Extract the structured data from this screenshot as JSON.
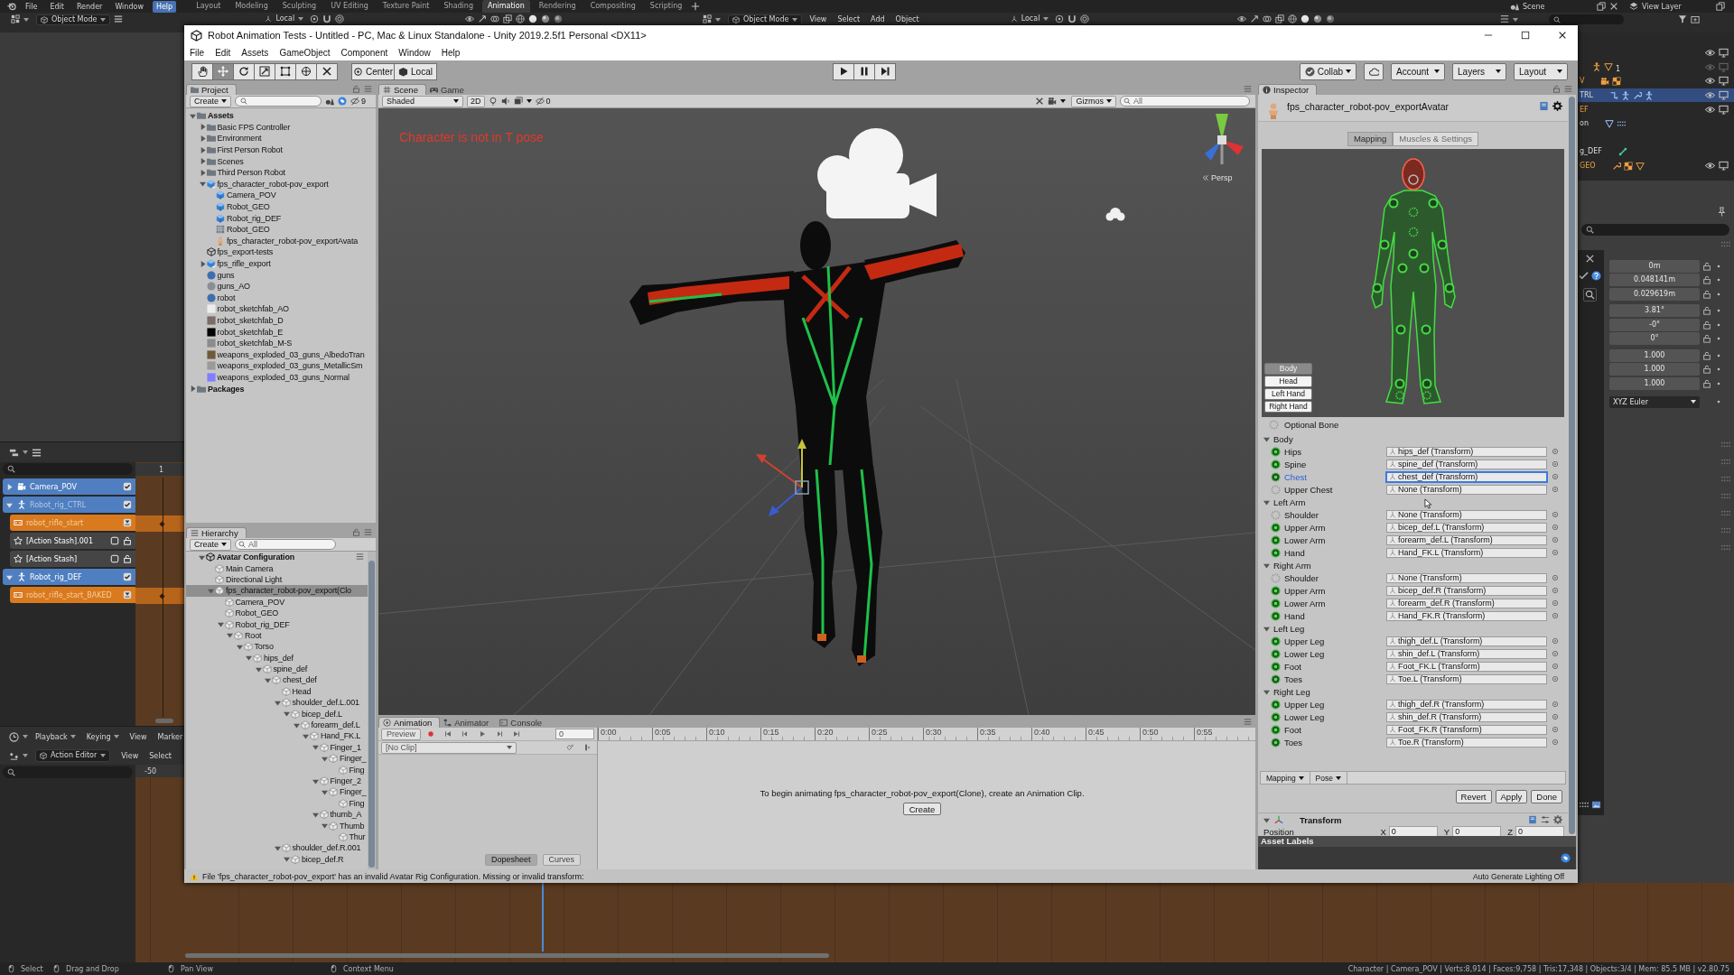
{
  "blender": {
    "menu": [
      {
        "label": "File",
        "highlighted": false
      },
      {
        "label": "Edit",
        "highlighted": false
      },
      {
        "label": "Render",
        "highlighted": false
      },
      {
        "label": "Window",
        "highlighted": false
      },
      {
        "label": "Help",
        "highlighted": true
      }
    ],
    "workspaces": [
      {
        "label": "Layout",
        "selected": false
      },
      {
        "label": "Modeling",
        "selected": false
      },
      {
        "label": "Sculpting",
        "selected": false
      },
      {
        "label": "UV Editing",
        "selected": false
      },
      {
        "label": "Texture Paint",
        "selected": false
      },
      {
        "label": "Shading",
        "selected": false
      },
      {
        "label": "Animation",
        "selected": true
      },
      {
        "label": "Rendering",
        "selected": false
      },
      {
        "label": "Compositing",
        "selected": false
      },
      {
        "label": "Scripting",
        "selected": false
      }
    ],
    "scene": "Scene",
    "view_layer": "View Layer",
    "viewport_header": {
      "mode": "Object Mode",
      "orientation": "Local"
    },
    "viewport_header_2": {
      "mode": "Object Mode",
      "menus": [
        "View",
        "Select",
        "Add",
        "Object"
      ],
      "orientation": "Local"
    },
    "outliner": {
      "rows": [
        {
          "kind": "object",
          "highlighted": false,
          "visible": true
        },
        {
          "kind": "armature",
          "count": "1",
          "highlighted": false,
          "selected": true,
          "visible": false
        },
        {
          "kind": "camera",
          "label": "V",
          "highlighted": false,
          "selected": true,
          "visible": true
        },
        {
          "kind": "rig",
          "label": "TRL",
          "highlighted": true,
          "selected": false,
          "visible": true
        },
        {
          "kind": "object",
          "label": "EF",
          "highlighted": false,
          "selected": true,
          "visible": true
        },
        {
          "kind": "action",
          "label": "on",
          "highlighted": false,
          "selected": false
        },
        {
          "kind": "bone",
          "label": "g_DEF",
          "highlighted": false,
          "selected": false
        },
        {
          "kind": "mesh",
          "label": "GEO",
          "highlighted": false,
          "selected": true,
          "visible": true
        }
      ]
    },
    "properties": {
      "groups": [
        [
          "0m",
          "0.048141m",
          "0.029619m"
        ],
        [
          "3.81°",
          "-0°",
          "0°"
        ],
        [
          "1.000",
          "1.000",
          "1.000"
        ]
      ],
      "rotation_mode": "XYZ Euler"
    },
    "nla": {
      "frame": "1",
      "tracks": [
        {
          "kind": "camera",
          "label": "Camera_POV",
          "expanded": false,
          "checked": true,
          "dimmed": false
        },
        {
          "kind": "armature",
          "label": "Robot_rig_CTRL",
          "expanded": true,
          "checked": true,
          "dimmed": true
        },
        {
          "kind": "action",
          "label": "robot_rifle_start",
          "dimmed": true
        },
        {
          "kind": "stash",
          "label": "[Action Stash].001",
          "checked": false,
          "dimmed": false
        },
        {
          "kind": "stash",
          "label": "[Action Stash]",
          "checked": false,
          "dimmed": false
        },
        {
          "kind": "armature",
          "label": "Robot_rig_DEF",
          "expanded": true,
          "checked": true,
          "dimmed": false
        },
        {
          "kind": "action",
          "label": "robot_rifle_start_BAKED",
          "dimmed": true
        }
      ]
    },
    "timeline": {
      "menus": [
        {
          "label": "Playback",
          "dropdown": true
        },
        {
          "label": "Keying",
          "dropdown": true
        },
        {
          "label": "View",
          "dropdown": false
        },
        {
          "label": "Marker",
          "dropdown": false
        }
      ]
    },
    "action_editor": {
      "mode": "Action Editor",
      "menus": [
        "View",
        "Select"
      ],
      "frame": "-50"
    },
    "status": {
      "hints": [
        "Select",
        "Drag and Drop",
        "Pan View",
        "Context Menu"
      ],
      "stats": "Character | Camera_POV | Verts:8,914 | Faces:9,758 | Tris:17,348 | Objects:3/4 | Mem: 85.5 MB | v2.80.75"
    }
  },
  "unity": {
    "title": "Robot Animation Tests - Untitled - PC, Mac & Linux Standalone - Unity 2019.2.5f1 Personal <DX11>",
    "menu": [
      "File",
      "Edit",
      "Assets",
      "GameObject",
      "Component",
      "Window",
      "Help"
    ],
    "tools": [
      {
        "selected": false
      },
      {
        "selected": true
      },
      {
        "selected": false
      },
      {
        "selected": false
      },
      {
        "selected": false
      },
      {
        "selected": false
      },
      {
        "selected": false
      }
    ],
    "pivot_mode": "Center",
    "pivot_rotation": "Local",
    "collab": "Collab",
    "account": "Account",
    "layers": "Layers",
    "layout": "Layout",
    "project": {
      "tab": "Project",
      "create": "Create",
      "hidden_count": "9",
      "items": [
        {
          "label": "Assets",
          "kind": "folder",
          "expanded": true,
          "children": [
            {
              "label": "Basic FPS Controller",
              "kind": "folder",
              "expanded": false
            },
            {
              "label": "Environment",
              "kind": "folder",
              "expanded": false
            },
            {
              "label": "First Person Robot",
              "kind": "folder",
              "expanded": false
            },
            {
              "label": "Scenes",
              "kind": "folder",
              "expanded": false
            },
            {
              "label": "Third Person Robot",
              "kind": "folder",
              "expanded": false
            },
            {
              "label": "fps_character_robot-pov_export",
              "kind": "model",
              "expanded": true,
              "children": [
                {
                  "label": "Camera_POV",
                  "kind": "cube"
                },
                {
                  "label": "Robot_GEO",
                  "kind": "cube"
                },
                {
                  "label": "Robot_rig_DEF",
                  "kind": "cube"
                },
                {
                  "label": "Robot_GEO",
                  "kind": "mesh"
                },
                {
                  "label": "fps_character_robot-pov_exportAvata",
                  "kind": "avatar"
                }
              ]
            },
            {
              "label": "fps_export-tests",
              "kind": "scene"
            },
            {
              "label": "fps_rifle_export",
              "kind": "model",
              "expanded": false
            },
            {
              "label": "guns",
              "kind": "material",
              "color": "#3d6fb0"
            },
            {
              "label": "guns_AO",
              "kind": "material",
              "color": "#8a8f96"
            },
            {
              "label": "robot",
              "kind": "material",
              "color": "#3d6fb0"
            },
            {
              "label": "robot_sketchfab_AO",
              "kind": "texture",
              "color": "#ededed"
            },
            {
              "label": "robot_sketchfab_D",
              "kind": "texture",
              "color": "#7a6c68"
            },
            {
              "label": "robot_sketchfab_E",
              "kind": "texture",
              "color": "#050505"
            },
            {
              "label": "robot_sketchfab_M-S",
              "kind": "texture",
              "color": "#8c8c8c"
            },
            {
              "label": "weapons_exploded_03_guns_AlbedoTran",
              "kind": "texture",
              "color": "#6e5a3a"
            },
            {
              "label": "weapons_exploded_03_guns_MetallicSm",
              "kind": "texture",
              "color": "#9a9a9a"
            },
            {
              "label": "weapons_exploded_03_guns_Normal",
              "kind": "texture",
              "color": "#7f7fff"
            }
          ]
        },
        {
          "label": "Packages",
          "kind": "folder",
          "expanded": false
        }
      ]
    },
    "hierarchy": {
      "tab": "Hierarchy",
      "create": "Create",
      "search_placeholder": "All",
      "scene": {
        "label": "Avatar Configuration",
        "expanded": true
      },
      "items": [
        {
          "label": "Main Camera",
          "selected": false
        },
        {
          "label": "Directional Light",
          "selected": false
        },
        {
          "label": "fps_character_robot-pov_export(Clo",
          "selected": true,
          "expanded": true,
          "children": [
            {
              "label": "Camera_POV",
              "selected": false
            },
            {
              "label": "Robot_GEO",
              "selected": false
            },
            {
              "label": "Robot_rig_DEF",
              "selected": false,
              "expanded": true,
              "children": [
                {
                  "label": "Root",
                  "selected": false,
                  "expanded": true,
                  "children": [
                    {
                      "label": "Torso",
                      "selected": false,
                      "expanded": true,
                      "children": [
                        {
                          "label": "hips_def",
                          "selected": false,
                          "expanded": true,
                          "children": [
                            {
                              "label": "spine_def",
                              "selected": false,
                              "expanded": true,
                              "children": [
                                {
                                  "label": "chest_def",
                                  "selected": false,
                                  "expanded": true,
                                  "children": [
                                    {
                                      "label": "Head",
                                      "selected": false
                                    },
                                    {
                                      "label": "shoulder_def.L.001",
                                      "selected": false,
                                      "expanded": true,
                                      "children": [
                                        {
                                          "label": "bicep_def.L",
                                          "selected": false,
                                          "expanded": true,
                                          "children": [
                                            {
                                              "label": "forearm_def.L",
                                              "selected": false,
                                              "expanded": true,
                                              "children": [
                                                {
                                                  "label": "Hand_FK.L",
                                                  "selected": false,
                                                  "expanded": true,
                                                  "children": [
                                                    {
                                                      "label": "Finger_1",
                                                      "selected": false,
                                                      "expanded": true,
                                                      "children": [
                                                        {
                                                          "label": "Finger_",
                                                          "selected": false,
                                                          "expanded": true,
                                                          "children": [
                                                            {
                                                              "label": "Fing",
                                                              "selected": false
                                                            }
                                                          ]
                                                        }
                                                      ]
                                                    },
                                                    {
                                                      "label": "Finger_2",
                                                      "selected": false,
                                                      "expanded": true,
                                                      "children": [
                                                        {
                                                          "label": "Finger_",
                                                          "selected": false,
                                                          "expanded": true,
                                                          "children": [
                                                            {
                                                              "label": "Fing",
                                                              "selected": false
                                                            }
                                                          ]
                                                        }
                                                      ]
                                                    },
                                                    {
                                                      "label": "thumb_A",
                                                      "selected": false,
                                                      "expanded": true,
                                                      "children": [
                                                        {
                                                          "label": "Thumb",
                                                          "selected": false,
                                                          "expanded": true,
                                                          "children": [
                                                            {
                                                              "label": "Thur",
                                                              "selected": false
                                                            }
                                                          ]
                                                        }
                                                      ]
                                                    }
                                                  ]
                                                }
                                              ]
                                            }
                                          ]
                                        }
                                      ]
                                    },
                                    {
                                      "label": "shoulder_def.R.001",
                                      "selected": false,
                                      "expanded": true,
                                      "children": [
                                        {
                                          "label": "bicep_def.R",
                                          "selected": false,
                                          "expanded": true
                                        }
                                      ]
                                    }
                                  ]
                                }
                              ]
                            }
                          ]
                        }
                      ]
                    }
                  ]
                }
              ]
            }
          ]
        }
      ]
    },
    "scene_view": {
      "tabs": [
        {
          "label": "Scene",
          "selected": true
        },
        {
          "label": "Game",
          "selected": false
        }
      ],
      "shading": "Shaded",
      "mode_2d": {
        "label": "2D",
        "on": false
      },
      "hidden_count": "0",
      "gizmos": "Gizmos",
      "search_placeholder": "All",
      "warning": "Character is not in T pose",
      "projection": "Persp"
    },
    "animation": {
      "tabs": [
        {
          "label": "Animation",
          "selected": true
        },
        {
          "label": "Animator",
          "selected": false
        },
        {
          "label": "Console",
          "selected": false
        }
      ],
      "preview": "Preview",
      "frame": "0",
      "clip": "[No Clip]",
      "ticks": [
        "0:00",
        "0:05",
        "0:10",
        "0:15",
        "0:20",
        "0:25",
        "0:30",
        "0:35",
        "0:40",
        "0:45",
        "0:50",
        "0:55"
      ],
      "message": "To begin animating fps_character_robot-pov_export(Clone), create an Animation Clip.",
      "create": "Create",
      "views": [
        {
          "label": "Dopesheet",
          "selected": true
        },
        {
          "label": "Curves",
          "selected": false
        }
      ]
    },
    "inspector": {
      "tab": "Inspector",
      "object": "fps_character_robot-pov_exportAvatar",
      "tabs": [
        {
          "label": "Mapping",
          "selected": true
        },
        {
          "label": "Muscles & Settings",
          "selected": false
        }
      ],
      "views": [
        {
          "label": "Body",
          "selected": true
        },
        {
          "label": "Head",
          "selected": false
        },
        {
          "label": "Left Hand",
          "selected": false
        },
        {
          "label": "Right Hand",
          "selected": false
        }
      ],
      "legend": "Optional Bone",
      "groups": [
        {
          "label": "Body",
          "expanded": true,
          "bones": [
            {
              "label": "Hips",
              "kind": "required",
              "mapped": true,
              "value": "hips_def (Transform)",
              "selected": false
            },
            {
              "label": "Spine",
              "kind": "required",
              "mapped": true,
              "value": "spine_def (Transform)",
              "selected": false
            },
            {
              "label": "Chest",
              "kind": "optional",
              "mapped": true,
              "value": "chest_def (Transform)",
              "selected": true
            },
            {
              "label": "Upper Chest",
              "kind": "optional",
              "mapped": false,
              "value": "None (Transform)",
              "selected": false
            }
          ]
        },
        {
          "label": "Left Arm",
          "expanded": true,
          "bones": [
            {
              "label": "Shoulder",
              "kind": "optional",
              "mapped": false,
              "value": "None (Transform)",
              "selected": false
            },
            {
              "label": "Upper Arm",
              "kind": "required",
              "mapped": true,
              "value": "bicep_def.L (Transform)",
              "selected": false
            },
            {
              "label": "Lower Arm",
              "kind": "required",
              "mapped": true,
              "value": "forearm_def.L (Transform)",
              "selected": false
            },
            {
              "label": "Hand",
              "kind": "required",
              "mapped": true,
              "value": "Hand_FK.L (Transform)",
              "selected": false
            }
          ]
        },
        {
          "label": "Right Arm",
          "expanded": true,
          "bones": [
            {
              "label": "Shoulder",
              "kind": "optional",
              "mapped": false,
              "value": "None (Transform)",
              "selected": false
            },
            {
              "label": "Upper Arm",
              "kind": "required",
              "mapped": true,
              "value": "bicep_def.R (Transform)",
              "selected": false
            },
            {
              "label": "Lower Arm",
              "kind": "required",
              "mapped": true,
              "value": "forearm_def.R (Transform)",
              "selected": false
            },
            {
              "label": "Hand",
              "kind": "required",
              "mapped": true,
              "value": "Hand_FK.R (Transform)",
              "selected": false
            }
          ]
        },
        {
          "label": "Left Leg",
          "expanded": true,
          "bones": [
            {
              "label": "Upper Leg",
              "kind": "required",
              "mapped": true,
              "value": "thigh_def.L (Transform)",
              "selected": false
            },
            {
              "label": "Lower Leg",
              "kind": "required",
              "mapped": true,
              "value": "shin_def.L (Transform)",
              "selected": false
            },
            {
              "label": "Foot",
              "kind": "required",
              "mapped": true,
              "value": "Foot_FK.L (Transform)",
              "selected": false
            },
            {
              "label": "Toes",
              "kind": "optional",
              "mapped": true,
              "value": "Toe.L (Transform)",
              "selected": false
            }
          ]
        },
        {
          "label": "Right Leg",
          "expanded": true,
          "bones": [
            {
              "label": "Upper Leg",
              "kind": "required",
              "mapped": true,
              "value": "thigh_def.R (Transform)",
              "selected": false
            },
            {
              "label": "Lower Leg",
              "kind": "required",
              "mapped": true,
              "value": "shin_def.R (Transform)",
              "selected": false
            },
            {
              "label": "Foot",
              "kind": "required",
              "mapped": true,
              "value": "Foot_FK.R (Transform)",
              "selected": false
            },
            {
              "label": "Toes",
              "kind": "optional",
              "mapped": true,
              "value": "Toe.R (Transform)",
              "selected": false
            }
          ]
        }
      ],
      "footer_menus": [
        "Mapping",
        "Pose"
      ],
      "buttons": [
        "Revert",
        "Apply",
        "Done"
      ],
      "component": {
        "label": "Transform",
        "expanded": true
      },
      "position": {
        "label": "Position",
        "fields": [
          {
            "axis": "X",
            "value": "0"
          },
          {
            "axis": "Y",
            "value": "0"
          },
          {
            "axis": "Z",
            "value": "0"
          }
        ]
      },
      "asset_labels": "Asset Labels"
    },
    "status": {
      "message": "File 'fps_character_robot-pov_export' has an invalid Avatar Rig Configuration. Missing or invalid transform:",
      "lighting": "Auto Generate Lighting Off"
    }
  }
}
